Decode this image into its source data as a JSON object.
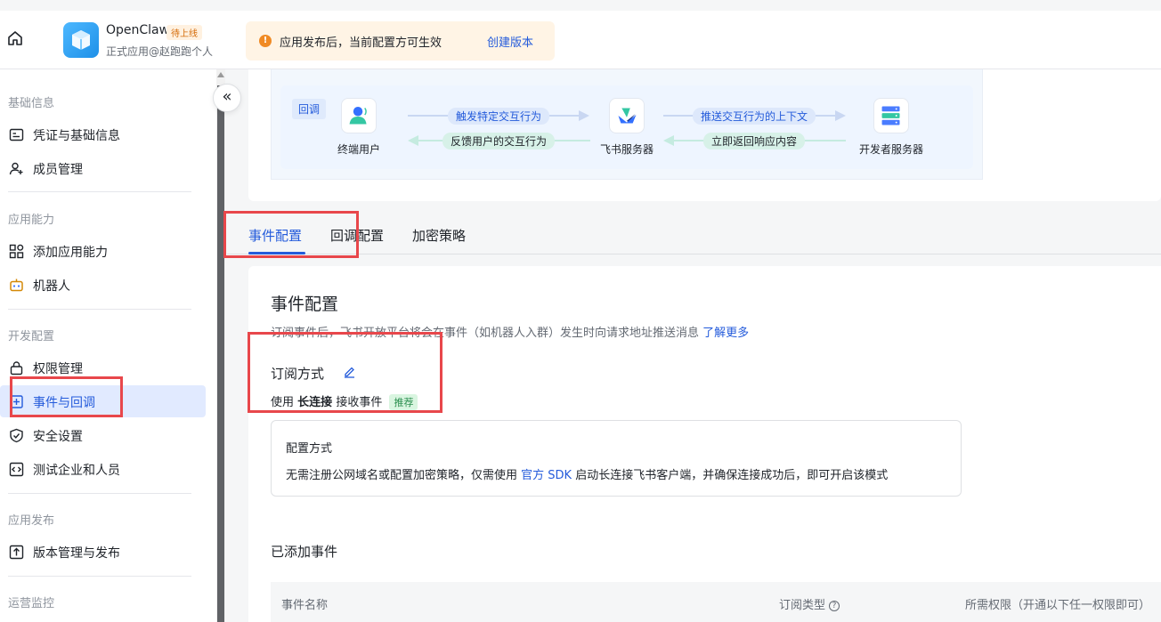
{
  "header": {
    "app_name": "OpenClaw",
    "app_badge": "待上线",
    "app_subtitle": "正式应用@赵跑跑个人",
    "notice_text": "应用发布后，当前配置方可生效",
    "notice_link": "创建版本"
  },
  "sidebar": {
    "sections": [
      {
        "title": "基础信息"
      },
      {
        "title": "应用能力"
      },
      {
        "title": "开发配置"
      },
      {
        "title": "应用发布"
      },
      {
        "title": "运营监控"
      }
    ],
    "items": [
      {
        "label": "凭证与基础信息",
        "icon": "credential-icon"
      },
      {
        "label": "成员管理",
        "icon": "member-add-icon"
      },
      {
        "label": "添加应用能力",
        "icon": "apps-grid-icon"
      },
      {
        "label": "机器人",
        "icon": "robot-icon"
      },
      {
        "label": "权限管理",
        "icon": "lock-icon"
      },
      {
        "label": "事件与回调",
        "icon": "event-icon",
        "active": true
      },
      {
        "label": "安全设置",
        "icon": "shield-icon"
      },
      {
        "label": "测试企业和人员",
        "icon": "code-icon"
      },
      {
        "label": "版本管理与发布",
        "icon": "upload-icon"
      }
    ]
  },
  "flow": {
    "tag": "回调",
    "nodes": [
      {
        "label": "终端用户"
      },
      {
        "label": "飞书服务器"
      },
      {
        "label": "开发者服务器"
      }
    ],
    "arrows": [
      {
        "label": "触发特定交互行为"
      },
      {
        "label": "反馈用户的交互行为"
      },
      {
        "label": "推送交互行为的上下文"
      },
      {
        "label": "立即返回响应内容"
      }
    ]
  },
  "tabs": [
    {
      "label": "事件配置",
      "active": true
    },
    {
      "label": "回调配置"
    },
    {
      "label": "加密策略"
    }
  ],
  "event_config": {
    "title": "事件配置",
    "description": "订阅事件后，飞书开放平台将会在事件（如机器人入群）发生时向请求地址推送消息",
    "learn_more": "了解更多",
    "subscribe_title": "订阅方式",
    "use_prefix": "使用",
    "use_mode": "长连接",
    "use_suffix": "接收事件",
    "recommend_badge": "推荐",
    "config_box": {
      "title": "配置方式",
      "desc_prefix": "无需注册公网域名或配置加密策略，仅需使用",
      "desc_link": "官方 SDK",
      "desc_suffix": "启动长连接飞书客户端，并确保连接成功后，即可开启该模式"
    },
    "added_title": "已添加事件",
    "table_headers": [
      "事件名称",
      "订阅类型",
      "所需权限（开通以下任一权限即可）"
    ]
  },
  "colors": {
    "accent": "#245bdb",
    "highlight_box": "#e8474b",
    "active_bg": "#e1eaff"
  }
}
